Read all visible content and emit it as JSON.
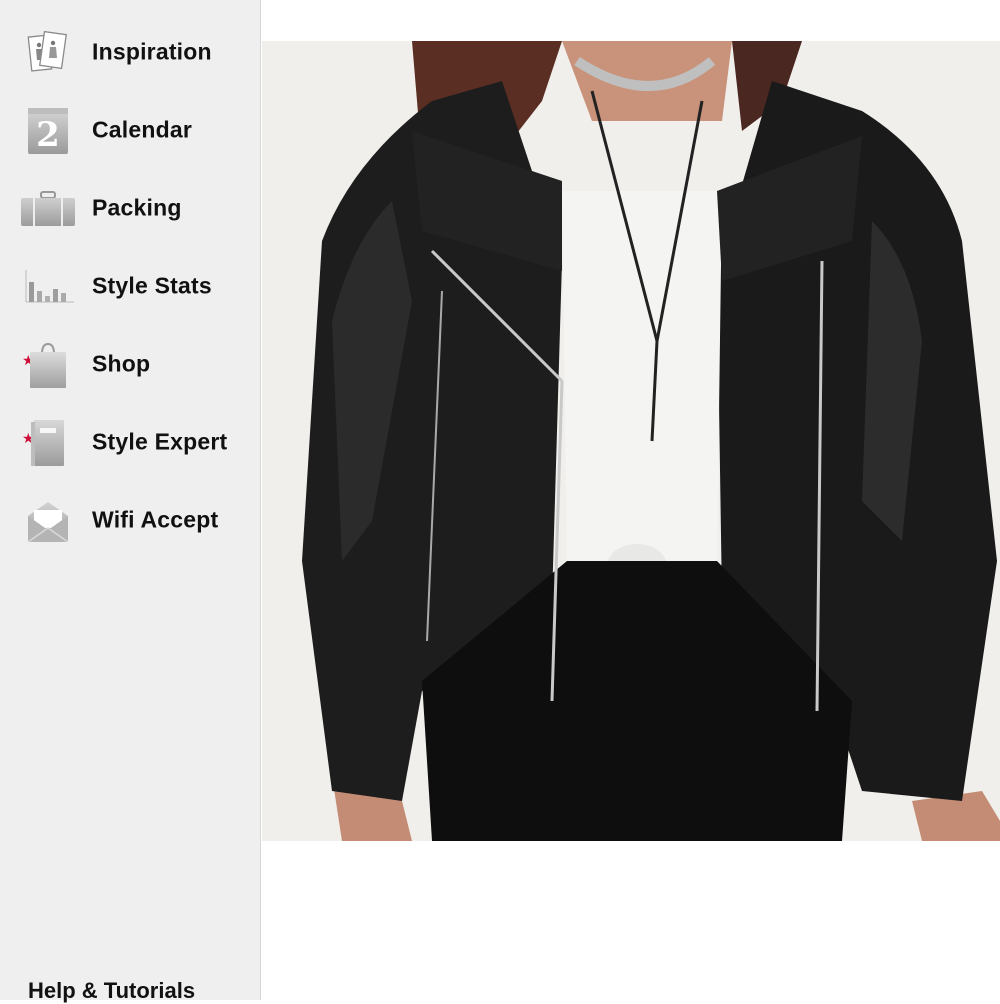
{
  "sidebar": {
    "items": [
      {
        "label": "Inspiration",
        "icon": "inspiration-icon",
        "starred": false
      },
      {
        "label": "Calendar",
        "icon": "calendar-icon",
        "starred": false
      },
      {
        "label": "Packing",
        "icon": "suitcase-icon",
        "starred": false
      },
      {
        "label": "Style Stats",
        "icon": "bar-chart-icon",
        "starred": false
      },
      {
        "label": "Shop",
        "icon": "shopping-bag-icon",
        "starred": true
      },
      {
        "label": "Style Expert",
        "icon": "book-icon",
        "starred": true
      },
      {
        "label": "Wifi Accept",
        "icon": "envelope-icon",
        "starred": false
      }
    ],
    "calendar_day": "2",
    "help_label": "Help & Tutorials"
  },
  "colors": {
    "sidebar_bg": "#efefef",
    "star": "#d0103a",
    "photo_bg": "#f1efec"
  },
  "main": {
    "image": "product-photo-black-leather-moto-jacket"
  }
}
